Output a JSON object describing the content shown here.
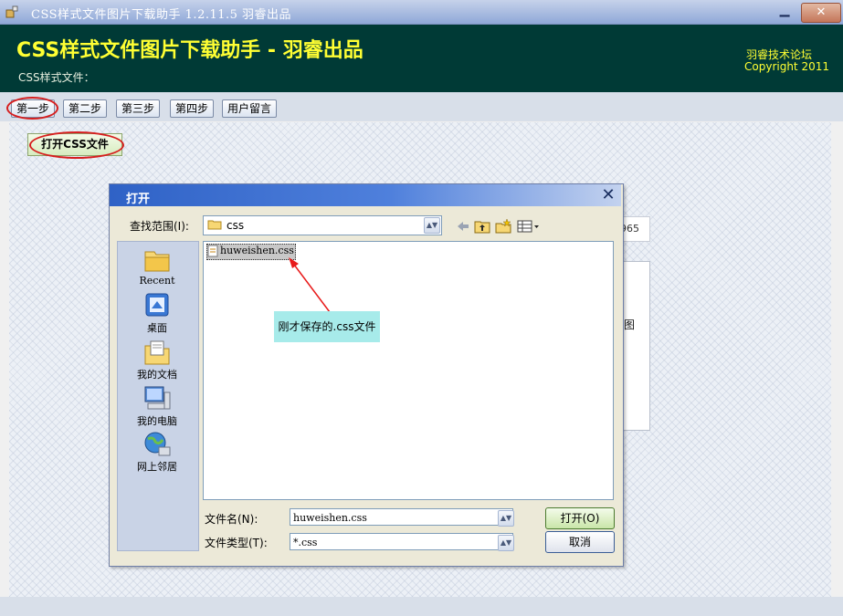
{
  "window": {
    "title": "CSS样式文件图片下载助手  1.2.11.5   羽睿出品",
    "minimize_glyph": "▁",
    "close_glyph": "✕"
  },
  "header": {
    "heading": "CSS样式文件图片下载助手 - 羽睿出品",
    "subtitle": "CSS样式文件：",
    "forum": "羽睿技术论坛",
    "copyright": "Copyright 2011"
  },
  "steps": [
    "第一步",
    "第二步",
    "第三步",
    "第四步",
    "用户留言"
  ],
  "open_css_button": "打开CSS文件",
  "background": {
    "field_fragment": "965",
    "panel_fragment": "图"
  },
  "dialog": {
    "title": "打开",
    "close_glyph": "✕",
    "look_in_label": "查找范围(I):",
    "look_in_value": "css",
    "places": [
      "Recent",
      "桌面",
      "我的文档",
      "我的电脑",
      "网上邻居"
    ],
    "files": [
      "huweishen.css"
    ],
    "callout": "刚才保存的.css文件",
    "file_name_label": "文件名(N):",
    "file_name_value": "huweishen.css",
    "file_type_label": "文件类型(T):",
    "file_type_value": "*.css",
    "open_button": "打开(O)",
    "cancel_button": "取消"
  },
  "colors": {
    "header_bg": "#003a36",
    "heading_yellow": "#ffff33",
    "annotation_red": "#d61e1e",
    "callout_bg": "#a7ebea",
    "dialog_title_blue": "#2f62c6"
  }
}
